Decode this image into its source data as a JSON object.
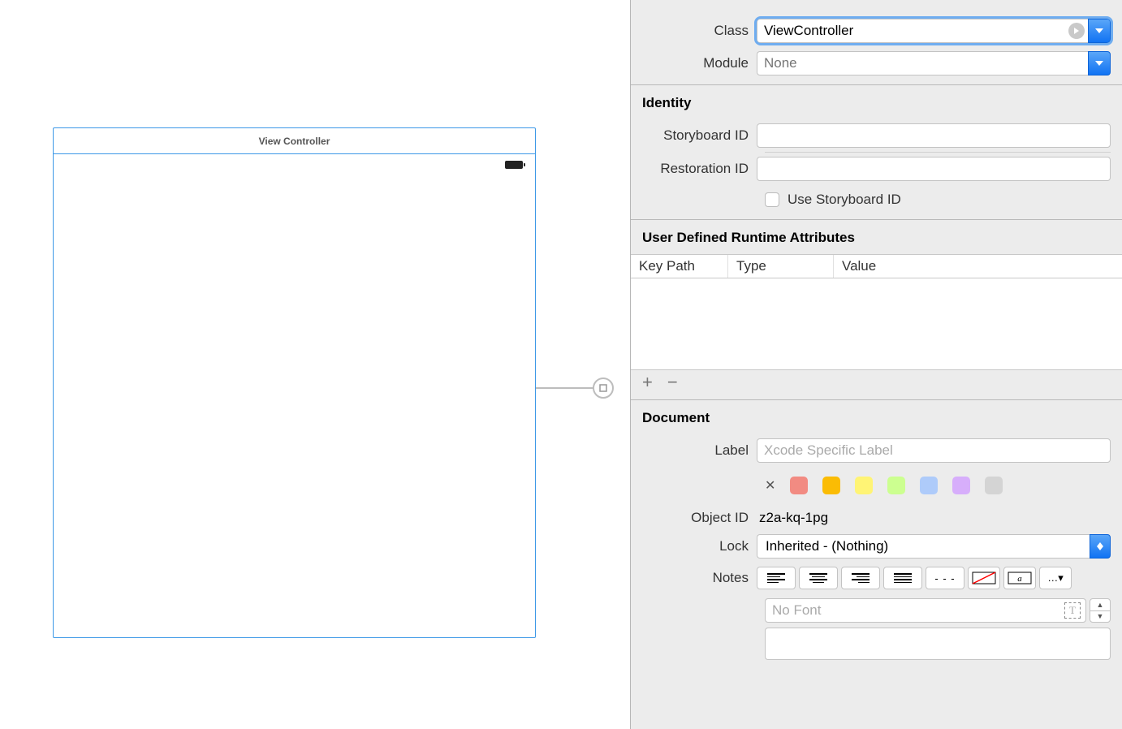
{
  "canvas": {
    "vc_title": "View Controller"
  },
  "customClass": {
    "class_label": "Class",
    "class_value": "ViewController",
    "module_label": "Module",
    "module_placeholder": "None"
  },
  "identity": {
    "section_title": "Identity",
    "storyboard_id_label": "Storyboard ID",
    "storyboard_id_value": "",
    "restoration_id_label": "Restoration ID",
    "restoration_id_value": "",
    "use_storyboard_checkbox_label": "Use Storyboard ID"
  },
  "runtime": {
    "section_title": "User Defined Runtime Attributes",
    "col_keypath": "Key Path",
    "col_type": "Type",
    "col_value": "Value"
  },
  "document": {
    "section_title": "Document",
    "label_label": "Label",
    "label_placeholder": "Xcode Specific Label",
    "color_swatches": [
      "#f28b82",
      "#fbbc04",
      "#fff475",
      "#ccff90",
      "#aecbfa",
      "#d7aefb",
      "#d4d4d4"
    ],
    "object_id_label": "Object ID",
    "object_id_value": "z2a-kq-1pg",
    "lock_label": "Lock",
    "lock_value": "Inherited - (Nothing)",
    "notes_label": "Notes",
    "font_placeholder": "No Font"
  }
}
